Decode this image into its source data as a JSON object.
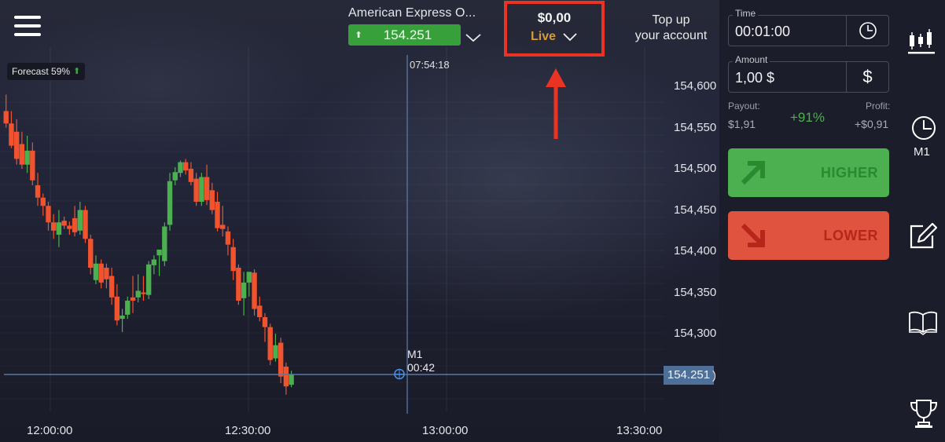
{
  "header": {
    "menu_icon": "hamburger-menu-icon",
    "asset_name": "American Express O...",
    "asset_price": "154.251",
    "asset_price_direction": "up",
    "balance_amount": "$0,00",
    "account_mode": "Live",
    "top_up_line1": "Top up",
    "top_up_line2": "your account"
  },
  "forecast": {
    "label": "Forecast 59%",
    "direction": "up"
  },
  "chart": {
    "crosshair_time": "07:54:18",
    "current_price": "154.251",
    "current_price_suffix": ")",
    "timeframe_label": "M1",
    "countdown": "00:42"
  },
  "trade_panel": {
    "time_label": "Time",
    "time_value": "00:01:00",
    "amount_label": "Amount",
    "amount_value": "1,00 $",
    "currency_symbol": "$",
    "payout_label": "Payout:",
    "payout_value": "$1,91",
    "payout_percent": "+91%",
    "profit_label": "Profit:",
    "profit_value": "+$0,91",
    "higher_label": "HIGHER",
    "lower_label": "LOWER"
  },
  "side_nav": {
    "items": [
      {
        "icon": "candlestick-chart-icon",
        "label": ""
      },
      {
        "icon": "clock-icon",
        "label": "M1"
      },
      {
        "icon": "edit-icon",
        "label": ""
      },
      {
        "icon": "book-icon",
        "label": ""
      },
      {
        "icon": "trophy-icon",
        "label": ""
      }
    ]
  },
  "colors": {
    "up": "#4caf50",
    "down": "#f0532e",
    "annotation": "#ea3323",
    "live": "#d59a3a",
    "price_tag": "#4d6f98"
  },
  "chart_data": {
    "type": "candlestick",
    "title": "American Express O...",
    "timeframe": "M1",
    "yticks": [
      "154,600",
      "154,550",
      "154,500",
      "154,450",
      "154,400",
      "154,350",
      "154,300"
    ],
    "ylim": [
      154.225,
      154.64
    ],
    "xticks": [
      "12:00:00",
      "12:30:00",
      "13:00:00",
      "13:30:00"
    ],
    "xlim_minutes_from_1200": [
      -7.6,
      101.4
    ],
    "current_price": 154.251,
    "crosshair_minute": 54.0,
    "candles": [
      {
        "t": -6.7,
        "o": 154.57,
        "h": 154.59,
        "c": 154.555,
        "l": 154.55
      },
      {
        "t": -5.9,
        "o": 154.555,
        "h": 154.57,
        "c": 154.528,
        "l": 154.525
      },
      {
        "t": -5.1,
        "o": 154.545,
        "h": 154.56,
        "c": 154.512,
        "l": 154.505
      },
      {
        "t": -4.3,
        "o": 154.53,
        "h": 154.545,
        "c": 154.505,
        "l": 154.5
      },
      {
        "t": -3.5,
        "o": 154.505,
        "h": 154.54,
        "c": 154.522,
        "l": 154.495
      },
      {
        "t": -2.7,
        "o": 154.522,
        "h": 154.532,
        "c": 154.486,
        "l": 154.48
      },
      {
        "t": -1.9,
        "o": 154.48,
        "h": 154.495,
        "c": 154.465,
        "l": 154.455
      },
      {
        "t": -1.1,
        "o": 154.465,
        "h": 154.47,
        "c": 154.455,
        "l": 154.443
      },
      {
        "t": -0.3,
        "o": 154.455,
        "h": 154.46,
        "c": 154.435,
        "l": 154.425
      },
      {
        "t": 0.5,
        "o": 154.435,
        "h": 154.445,
        "c": 154.425,
        "l": 154.415
      },
      {
        "t": 1.3,
        "o": 154.42,
        "h": 154.45,
        "c": 154.435,
        "l": 154.405
      },
      {
        "t": 2.1,
        "o": 154.437,
        "h": 154.442,
        "c": 154.431,
        "l": 154.427
      },
      {
        "t": 2.9,
        "o": 154.431,
        "h": 154.436,
        "c": 154.427,
        "l": 154.42
      },
      {
        "t": 3.7,
        "o": 154.44,
        "h": 154.455,
        "c": 154.423,
        "l": 154.418
      },
      {
        "t": 4.5,
        "o": 154.425,
        "h": 154.46,
        "c": 154.45,
        "l": 154.42
      },
      {
        "t": 5.3,
        "o": 154.45,
        "h": 154.455,
        "c": 154.415,
        "l": 154.41
      },
      {
        "t": 6.1,
        "o": 154.415,
        "h": 154.42,
        "c": 154.38,
        "l": 154.372
      },
      {
        "t": 6.9,
        "o": 154.365,
        "h": 154.395,
        "c": 154.385,
        "l": 154.36
      },
      {
        "t": 7.7,
        "o": 154.385,
        "h": 154.39,
        "c": 154.362,
        "l": 154.355
      },
      {
        "t": 8.5,
        "o": 154.38,
        "h": 154.385,
        "c": 154.366,
        "l": 154.355
      },
      {
        "t": 9.3,
        "o": 154.37,
        "h": 154.38,
        "c": 154.344,
        "l": 154.335
      },
      {
        "t": 10.1,
        "o": 154.345,
        "h": 154.36,
        "c": 154.316,
        "l": 154.31
      },
      {
        "t": 10.9,
        "o": 154.318,
        "h": 154.33,
        "c": 154.322,
        "l": 154.302
      },
      {
        "t": 11.7,
        "o": 154.323,
        "h": 154.345,
        "c": 154.34,
        "l": 154.318
      },
      {
        "t": 12.5,
        "o": 154.344,
        "h": 154.37,
        "c": 154.34,
        "l": 154.325
      },
      {
        "t": 13.3,
        "o": 154.344,
        "h": 154.372,
        "c": 154.352,
        "l": 154.338
      },
      {
        "t": 14.1,
        "o": 154.35,
        "h": 154.37,
        "c": 154.348,
        "l": 154.34
      },
      {
        "t": 14.9,
        "o": 154.347,
        "h": 154.388,
        "c": 154.384,
        "l": 154.342
      },
      {
        "t": 15.7,
        "o": 154.383,
        "h": 154.395,
        "c": 154.39,
        "l": 154.372
      },
      {
        "t": 16.5,
        "o": 154.395,
        "h": 154.4,
        "c": 154.402,
        "l": 154.37
      },
      {
        "t": 17.3,
        "o": 154.388,
        "h": 154.435,
        "c": 154.43,
        "l": 154.382
      },
      {
        "t": 18.1,
        "o": 154.432,
        "h": 154.495,
        "c": 154.485,
        "l": 154.425
      },
      {
        "t": 18.9,
        "o": 154.486,
        "h": 154.502,
        "c": 154.496,
        "l": 154.48
      },
      {
        "t": 19.7,
        "o": 154.495,
        "h": 154.51,
        "c": 154.508,
        "l": 154.49
      },
      {
        "t": 20.5,
        "o": 154.508,
        "h": 154.512,
        "c": 154.498,
        "l": 154.493
      },
      {
        "t": 21.3,
        "o": 154.5,
        "h": 154.508,
        "c": 154.484,
        "l": 154.48
      },
      {
        "t": 22.1,
        "o": 154.488,
        "h": 154.495,
        "c": 154.46,
        "l": 154.455
      },
      {
        "t": 22.9,
        "o": 154.46,
        "h": 154.495,
        "c": 154.49,
        "l": 154.455
      },
      {
        "t": 23.7,
        "o": 154.49,
        "h": 154.505,
        "c": 154.462,
        "l": 154.456
      },
      {
        "t": 24.5,
        "o": 154.474,
        "h": 154.483,
        "c": 154.45,
        "l": 154.445
      },
      {
        "t": 25.3,
        "o": 154.46,
        "h": 154.472,
        "c": 154.428,
        "l": 154.424
      },
      {
        "t": 26.1,
        "o": 154.432,
        "h": 154.455,
        "c": 154.427,
        "l": 154.418
      },
      {
        "t": 26.9,
        "o": 154.424,
        "h": 154.43,
        "c": 154.408,
        "l": 154.395
      },
      {
        "t": 27.7,
        "o": 154.405,
        "h": 154.415,
        "c": 154.376,
        "l": 154.365
      },
      {
        "t": 28.5,
        "o": 154.38,
        "h": 154.384,
        "c": 154.34,
        "l": 154.335
      },
      {
        "t": 29.3,
        "o": 154.343,
        "h": 154.375,
        "c": 154.362,
        "l": 154.322
      },
      {
        "t": 30.1,
        "o": 154.362,
        "h": 154.37,
        "c": 154.375,
        "l": 154.345
      },
      {
        "t": 30.9,
        "o": 154.374,
        "h": 154.378,
        "c": 154.33,
        "l": 154.322
      },
      {
        "t": 31.7,
        "o": 154.334,
        "h": 154.345,
        "c": 154.32,
        "l": 154.315
      },
      {
        "t": 32.5,
        "o": 154.32,
        "h": 154.325,
        "c": 154.308,
        "l": 154.29
      },
      {
        "t": 33.3,
        "o": 154.308,
        "h": 154.312,
        "c": 154.268,
        "l": 154.262
      },
      {
        "t": 34.1,
        "o": 154.27,
        "h": 154.3,
        "c": 154.286,
        "l": 154.266
      },
      {
        "t": 34.9,
        "o": 154.289,
        "h": 154.295,
        "c": 154.248,
        "l": 154.24
      },
      {
        "t": 35.7,
        "o": 154.26,
        "h": 154.265,
        "c": 154.236,
        "l": 154.226
      },
      {
        "t": 36.5,
        "o": 154.238,
        "h": 154.255,
        "c": 154.251,
        "l": 154.235
      }
    ]
  }
}
